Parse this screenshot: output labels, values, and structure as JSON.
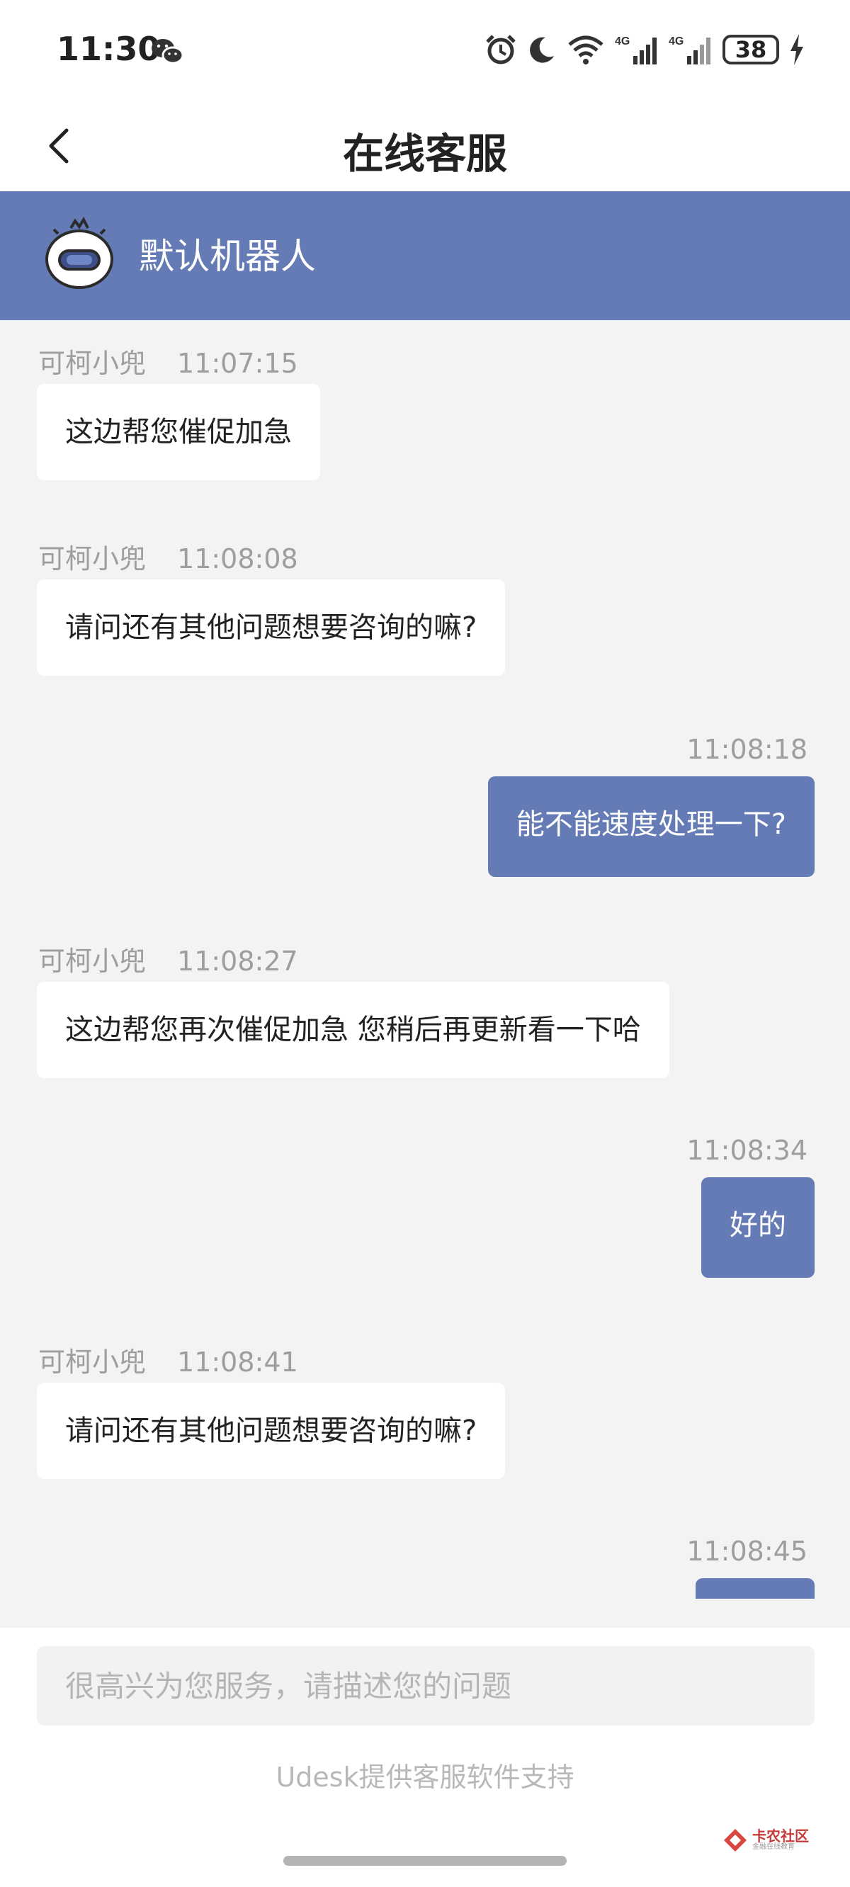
{
  "status_bar": {
    "time": "11:30",
    "icons": [
      "wechat-icon",
      "alarm-icon",
      "moon-icon",
      "wifi-icon",
      "signal-4g-icon",
      "signal-4g-icon",
      "charging-icon"
    ],
    "battery": "38"
  },
  "nav": {
    "title": "在线客服",
    "back_icon": "chevron-left-icon"
  },
  "robot": {
    "name": "默认机器人",
    "avatar_icon": "robot-icon",
    "header_color": "#647bb5"
  },
  "messages": [
    {
      "side": "agent",
      "sender": "可柯小兜",
      "time": "11:07:15",
      "text": "这边帮您催促加急"
    },
    {
      "side": "agent",
      "sender": "可柯小兜",
      "time": "11:08:08",
      "text": "请问还有其他问题想要咨询的嘛?"
    },
    {
      "side": "user",
      "time": "11:08:18",
      "text": "能不能速度处理一下?"
    },
    {
      "side": "agent",
      "sender": "可柯小兜",
      "time": "11:08:27",
      "text": "这边帮您再次催促加急 您稍后再更新看一下哈"
    },
    {
      "side": "user",
      "time": "11:08:34",
      "text": "好的"
    },
    {
      "side": "agent",
      "sender": "可柯小兜",
      "time": "11:08:41",
      "text": "请问还有其他问题想要咨询的嘛?"
    },
    {
      "side": "user",
      "time": "11:08:45",
      "text": ""
    }
  ],
  "input": {
    "placeholder": "很高兴为您服务，请描述您的问题",
    "value": ""
  },
  "footer": {
    "powered_by": "Udesk提供客服软件支持"
  },
  "watermark": {
    "text": "卡农社区",
    "sub": "金融在线教育"
  },
  "colors": {
    "accent": "#647bb5",
    "background": "#f3f3f4",
    "meta_text": "#9e9e9e"
  }
}
